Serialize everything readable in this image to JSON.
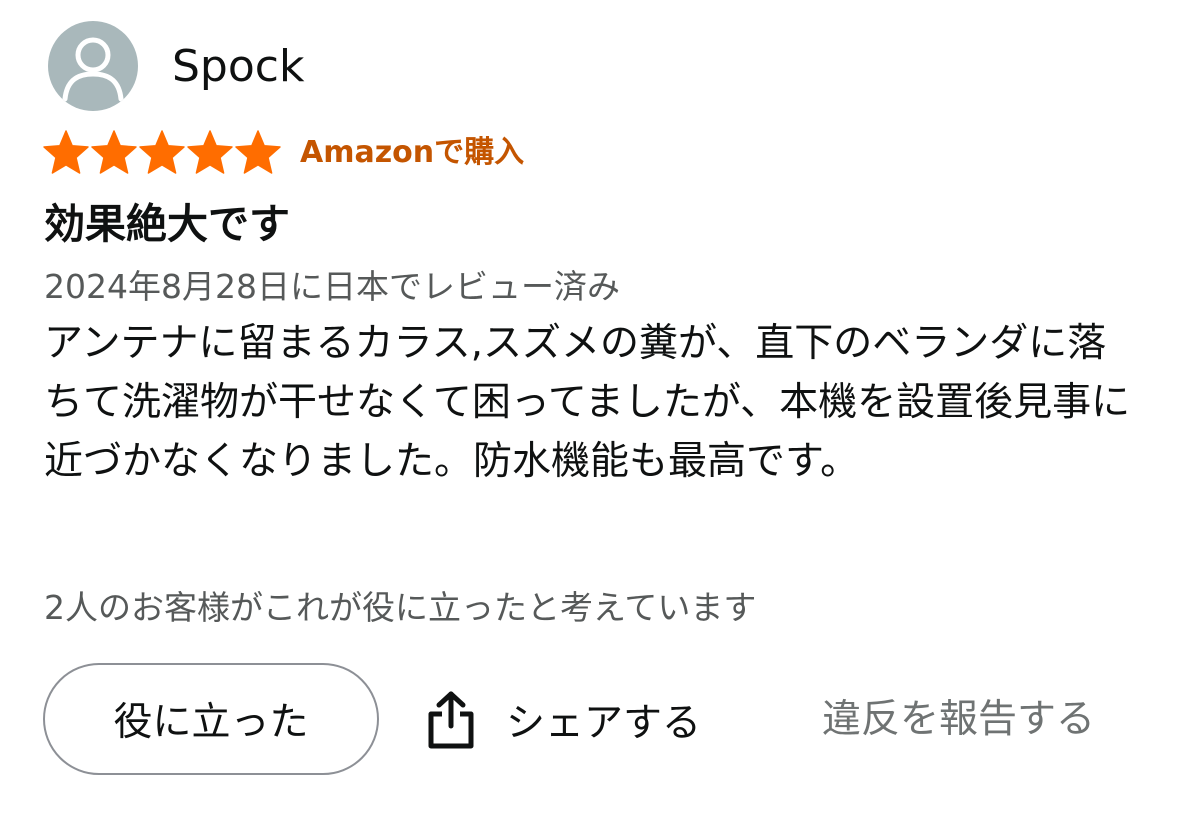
{
  "reviewer": {
    "name": "Spock",
    "avatar_icon": "user-silhouette-icon",
    "avatar_color": "#a9b8bb"
  },
  "rating": {
    "stars": 5,
    "max": 5,
    "star_color": "#ff6d00"
  },
  "badge": {
    "verified_label": "Amazonで購入",
    "color": "#c45500"
  },
  "review": {
    "title": "効果絶大です",
    "date": "2024年8月28日に日本でレビュー済み",
    "body": "アンテナに留まるカラス,スズメの糞が、直下のベランダに落ちて洗濯物が干せなくて困ってましたが、本機を設置後見事に近づかなくなりました。防水機能も最高です。"
  },
  "helpful": {
    "count_text": "2人のお客様がこれが役に立ったと考えています"
  },
  "actions": {
    "helpful_label": "役に立った",
    "share_label": "シェアする",
    "share_icon": "share-icon",
    "report_label": "違反を報告する"
  }
}
